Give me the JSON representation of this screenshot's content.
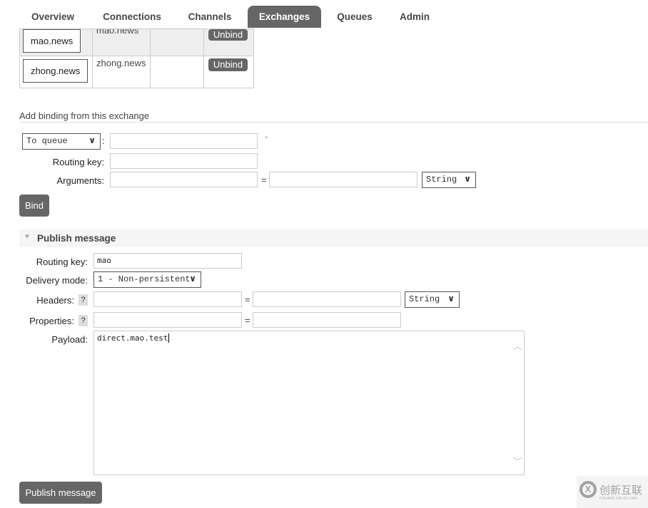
{
  "nav": {
    "tabs": [
      {
        "label": "Overview"
      },
      {
        "label": "Connections"
      },
      {
        "label": "Channels"
      },
      {
        "label": "Exchanges",
        "active": true
      },
      {
        "label": "Queues"
      },
      {
        "label": "Admin"
      }
    ]
  },
  "bindings": [
    {
      "to": "mao.news",
      "routing_key": "mao.news",
      "arguments": "",
      "action": "Unbind"
    },
    {
      "to": "zhong.news",
      "routing_key": "zhong.news",
      "arguments": "",
      "action": "Unbind"
    }
  ],
  "add_binding": {
    "heading": "Add binding from this exchange",
    "destination_type": "To queue",
    "colon": ":",
    "required_mark": "*",
    "routing_key_label": "Routing key:",
    "arguments_label": "Arguments:",
    "equals": "=",
    "arg_type": "String",
    "bind_label": "Bind"
  },
  "publish": {
    "heading": "Publish message",
    "routing_key_label": "Routing key:",
    "routing_key_value": "mao",
    "delivery_mode_label": "Delivery mode:",
    "delivery_mode_value": "1 - Non-persistent",
    "headers_label": "Headers:",
    "help": "?",
    "header_type": "String",
    "properties_label": "Properties:",
    "equals": "=",
    "payload_label": "Payload:",
    "payload_value": "direct.mao.test",
    "button_label": "Publish message"
  },
  "watermark": {
    "text": "创新互联",
    "subtext": "CHUANG XIN HU LIAN"
  }
}
